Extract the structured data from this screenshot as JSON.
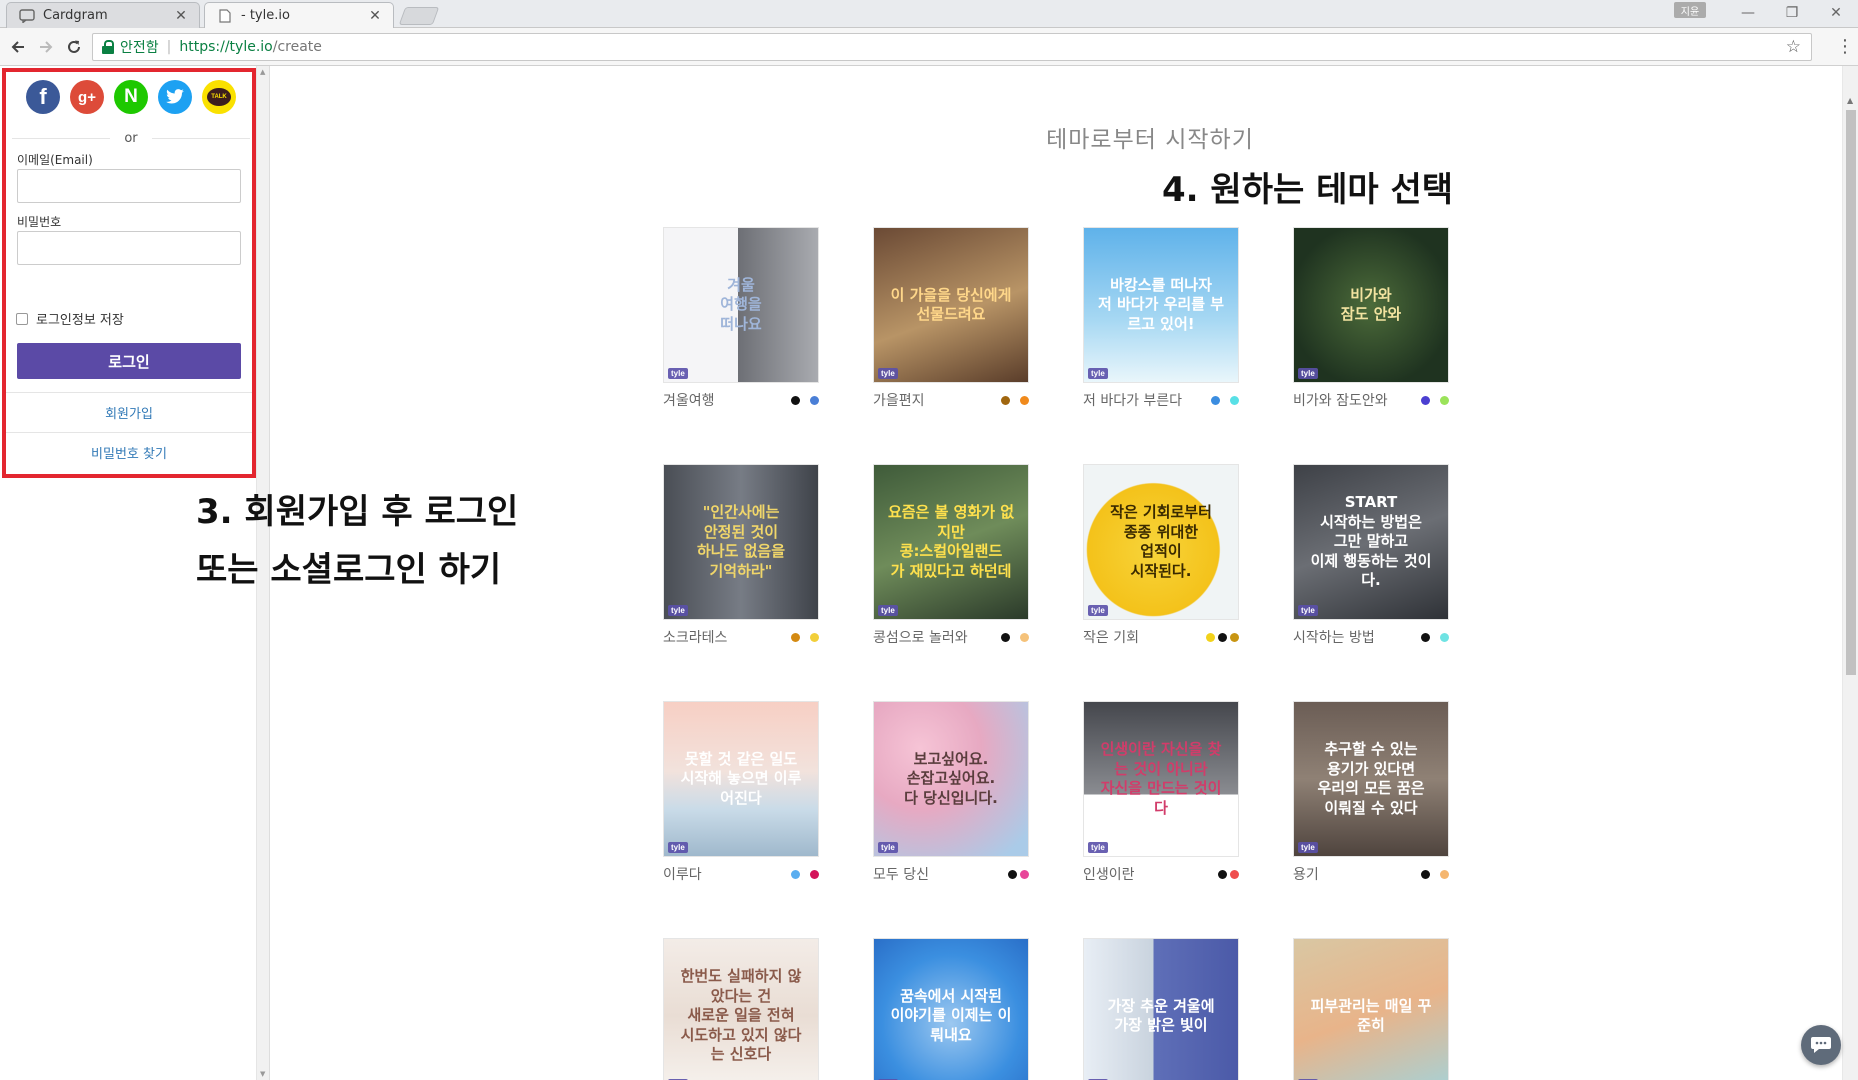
{
  "browser": {
    "tabs": [
      {
        "title": "Cardgram",
        "close": "✕"
      },
      {
        "title": "- tyle.io",
        "close": "✕"
      }
    ],
    "user_badge": "지윤",
    "window_controls": {
      "minimize": "—",
      "maximize": "❐",
      "close": "✕"
    },
    "secure_label": "안전함",
    "url_host": "https://tyle.io",
    "url_path": "/create",
    "icons": [
      "back-icon",
      "forward-icon",
      "reload-icon",
      "lock-icon",
      "star-icon",
      "menu-icon"
    ]
  },
  "login": {
    "social": [
      {
        "name": "facebook",
        "glyph": "f",
        "color": "#3b5998"
      },
      {
        "name": "google-plus",
        "glyph": "g+",
        "color": "#dd4b39"
      },
      {
        "name": "naver",
        "glyph": "N",
        "color": "#1ec800"
      },
      {
        "name": "twitter",
        "glyph": "",
        "color": "#1da1f2"
      },
      {
        "name": "kakaotalk",
        "glyph": "TALK",
        "color": "#fae100"
      }
    ],
    "or_label": "or",
    "email_label": "이메일(Email)",
    "email_value": "",
    "password_label": "비밀번호",
    "password_value": "",
    "remember_label": "로그인정보 저장",
    "login_button": "로그인",
    "signup_link": "회원가입",
    "find_password_link": "비밀번호 찾기",
    "highlight_color": "#e3262f",
    "button_color": "#5b4aa6"
  },
  "annotations": {
    "step3_line1": "3. 회원가입 후 로그인",
    "step3_line2": "또는 소셜로그인 하기",
    "step4": "4. 원하는 테마 선택"
  },
  "main": {
    "title": "테마로부터 시작하기",
    "themes": [
      {
        "label": "겨울여행",
        "thumb_text": "겨울\n여행을\n떠나요",
        "bg": "linear-gradient(90deg,#f5f5f7 0%,#f5f5f7 48%,#6d6f75 48%,#a9abb0 100%)",
        "fg": "#9fb5d9",
        "dots": [
          "#111111",
          "#4a7fd6"
        ]
      },
      {
        "label": "가을편지",
        "thumb_text": "이 가을을 당신에게\n선물드려요",
        "bg": "linear-gradient(160deg,#6b4a35,#b89466 55%,#5a3d2a)",
        "fg": "#ffd78a",
        "dots": [
          "#a0660f",
          "#f08a1c"
        ]
      },
      {
        "label": "저 바다가 부른다",
        "thumb_text": "바캉스를 떠나자\n저 바다가 우리를 부르고 있어!",
        "bg": "linear-gradient(180deg,#5fb2ea,#a7d8f3 60%,#e9f6fb)",
        "fg": "#ffffff",
        "dots": [
          "#3b8de0",
          "#58e0e6"
        ]
      },
      {
        "label": "비가와 잠도안와",
        "thumb_text": "비가와\n잠도 안와",
        "bg": "radial-gradient(circle at 50% 50%,#4c6b3a,#1f3320 75%)",
        "fg": "#f2e3a0",
        "dots": [
          "#4b3fd1",
          "#9be35a"
        ]
      },
      {
        "label": "소크라테스",
        "thumb_text": "\"인간사에는\n안정된 것이\n하나도 없음을\n기억하라\"",
        "bg": "linear-gradient(90deg,#4a4e55,#777c85 50%,#3f434a)",
        "fg": "#f0d66a",
        "dots": [
          "#d48a12",
          "#f2cf3a"
        ]
      },
      {
        "label": "콩섬으로 놀러와",
        "thumb_text": "요즘은 볼 영화가 없지만\n콩:스컬아일랜드\n가 재밌다고 하던데",
        "bg": "linear-gradient(160deg,#3f5b3a,#6f8c5a 50%,#2b3a2a)",
        "fg": "#ffe14d",
        "dots": [
          "#111111",
          "#f5c27a"
        ]
      },
      {
        "label": "작은 기회",
        "thumb_text": "작은 기회로부터\n종종 위대한\n업적이\n시작된다.",
        "bg": "radial-gradient(circle at 45% 55%,#f7d43a,#f4c21a 55%,#f0f4f5 56%)",
        "fg": "#3a2a00",
        "dots": [
          "#f2d21b",
          "#111111",
          "#c89512"
        ]
      },
      {
        "label": "시작하는 방법",
        "thumb_text": "START\n시작하는 방법은\n그만 말하고\n이제 행동하는 것이다.",
        "bg": "linear-gradient(160deg,#3e4147,#6b6e74 50%,#2f3237)",
        "fg": "#ffffff",
        "dots": [
          "#111111",
          "#6fe3e3"
        ]
      },
      {
        "label": "이루다",
        "thumb_text": "못할 것 같은 일도\n시작해 놓으면 이루어진다",
        "bg": "linear-gradient(180deg,#f7cfc4,#f2e2dc 45%,#c9dbe8 70%,#9fb8cc)",
        "fg": "#ffffff",
        "dots": [
          "#5aaef0",
          "#d4145a"
        ]
      },
      {
        "label": "모두 당신",
        "thumb_text": "보고싶어요.\n손잡고싶어요.\n다 당신입니다.",
        "bg": "radial-gradient(circle at 30% 30%,#f6c4d6,#e7a9c2 40%,#aacbe8 90%)",
        "fg": "#5a3d3d",
        "dots": [
          "#ffffff",
          "#111111",
          "#e8479a"
        ]
      },
      {
        "label": "인생이란",
        "thumb_text": "인생이란 자신을 찾는 것이 아니라\n자신을 만드는 것이다",
        "bg": "linear-gradient(180deg,#45474d 0%,#8a8c91 60%,#ffffff 60%)",
        "fg": "#d23c6a",
        "dots": [
          "#ffffff",
          "#111111",
          "#ef4d4d"
        ]
      },
      {
        "label": "용기",
        "thumb_text": "추구할 수 있는\n용기가 있다면\n우리의 모든 꿈은\n이뤄질 수 있다",
        "bg": "linear-gradient(180deg,#6b5d55,#8f8175 50%,#4f443e)",
        "fg": "#ffffff",
        "dots": [
          "#111111",
          "#f5b66f"
        ]
      },
      {
        "label": "",
        "thumb_text": "한번도 실패하지 않았다는 건\n새로운 일을 전혀\n시도하고 있지 않다는 신호다",
        "bg": "linear-gradient(180deg,#f3ece7,#e9ddd4 50%,#f7f3ef)",
        "fg": "#8a5a4a",
        "dots": []
      },
      {
        "label": "",
        "thumb_text": "꿈속에서 시작된\n이야기를 이제는 이뤄내요",
        "bg": "radial-gradient(circle at 50% 55%,#9cc8f0,#3b8fe0 60%,#2a6fc8)",
        "fg": "#ffffff",
        "dots": []
      },
      {
        "label": "",
        "thumb_text": "가장 추운 겨울에\n가장 밝은 빛이",
        "bg": "linear-gradient(90deg,#e8eef5 0%,#c9d3de 45%,#5f6fb8 45%,#4b5aa8 100%)",
        "fg": "#ffffff",
        "dots": []
      },
      {
        "label": "",
        "thumb_text": "피부관리는 매일 꾸준히",
        "bg": "linear-gradient(160deg,#d9c7a3,#e8b48a 50%,#a5d2d8)",
        "fg": "#ffffff",
        "dots": []
      }
    ]
  },
  "chat_button": "chat-icon"
}
